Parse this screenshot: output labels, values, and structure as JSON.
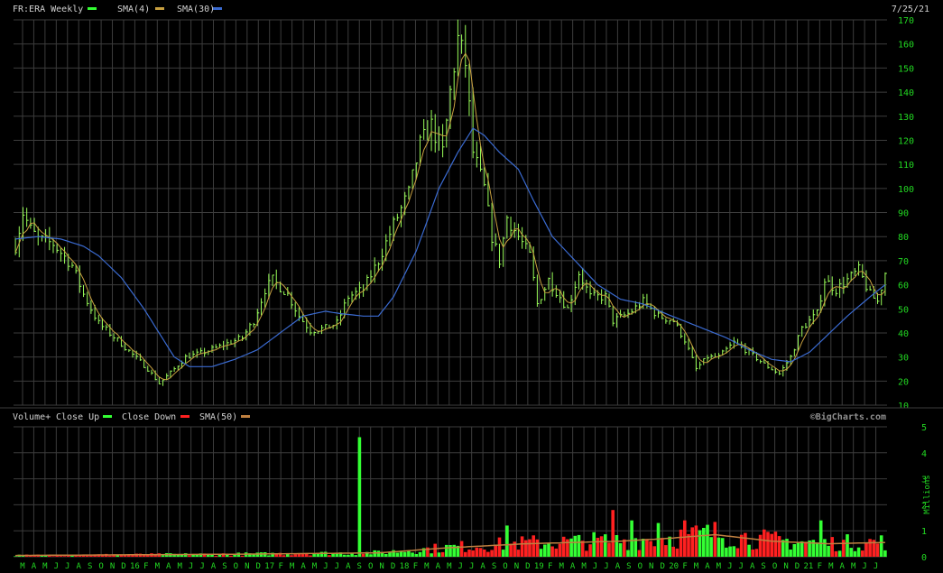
{
  "header": {
    "symbol_label": "FR:ERA Weekly",
    "sma4_label": "SMA(4)",
    "sma30_label": "SMA(30)",
    "date": "7/25/21"
  },
  "volume_header": {
    "label": "Volume+",
    "close_up_label": "Close Up",
    "close_down_label": "Close Down",
    "sma50_label": "SMA(50)",
    "watermark": "©BigCharts.com",
    "unit_label": "Millions"
  },
  "colors": {
    "background": "#000000",
    "grid": "#3c3c3c",
    "price_bar": "#9aff5a",
    "axis_text": "#22d822",
    "header_text": "#d0d0d0",
    "sma4": "#c8a040",
    "sma30": "#3a6ad0",
    "vol_up": "#33ff33",
    "vol_down": "#ff2020",
    "vol_sma": "#c08040",
    "watermark": "#909090"
  },
  "chart_data": [
    {
      "type": "line",
      "title": "FR:ERA Weekly",
      "ylim": [
        10,
        170
      ],
      "yticks": [
        10,
        20,
        30,
        40,
        50,
        60,
        70,
        80,
        90,
        100,
        110,
        120,
        130,
        140,
        150,
        160,
        170
      ],
      "grid": true,
      "legend": "top-left",
      "x_labels": [
        "M",
        "A",
        "M",
        "J",
        "J",
        "A",
        "S",
        "O",
        "N",
        "D",
        "16",
        "F",
        "M",
        "A",
        "M",
        "J",
        "J",
        "A",
        "S",
        "O",
        "N",
        "D",
        "17",
        "F",
        "M",
        "A",
        "M",
        "J",
        "J",
        "A",
        "S",
        "O",
        "N",
        "D",
        "18",
        "F",
        "M",
        "A",
        "M",
        "J",
        "J",
        "A",
        "S",
        "O",
        "N",
        "D",
        "19",
        "F",
        "M",
        "A",
        "M",
        "J",
        "J",
        "A",
        "S",
        "O",
        "N",
        "D",
        "20",
        "F",
        "M",
        "A",
        "M",
        "J",
        "J",
        "A",
        "S",
        "O",
        "N",
        "D",
        "21",
        "F",
        "M",
        "A",
        "M",
        "J",
        "J"
      ],
      "series": [
        {
          "name": "FR:ERA Weekly",
          "key_points": [
            [
              0,
              76
            ],
            [
              2,
              90
            ],
            [
              4,
              83
            ],
            [
              6,
              79
            ],
            [
              10,
              77
            ],
            [
              15,
              68
            ],
            [
              18,
              56
            ],
            [
              22,
              44
            ],
            [
              27,
              37
            ],
            [
              31,
              31
            ],
            [
              35,
              25
            ],
            [
              38,
              19
            ],
            [
              42,
              25
            ],
            [
              45,
              30
            ],
            [
              50,
              32
            ],
            [
              55,
              35
            ],
            [
              60,
              38
            ],
            [
              63,
              45
            ],
            [
              66,
              58
            ],
            [
              68,
              62
            ],
            [
              72,
              56
            ],
            [
              75,
              47
            ],
            [
              78,
              41
            ],
            [
              82,
              42
            ],
            [
              85,
              44
            ],
            [
              88,
              55
            ],
            [
              92,
              58
            ],
            [
              96,
              70
            ],
            [
              100,
              85
            ],
            [
              104,
              98
            ],
            [
              107,
              118
            ],
            [
              110,
              126
            ],
            [
              113,
              115
            ],
            [
              115,
              140
            ],
            [
              117,
              162
            ],
            [
              119,
              152
            ],
            [
              121,
              115
            ],
            [
              124,
              100
            ],
            [
              126,
              80
            ],
            [
              128,
              70
            ],
            [
              130,
              88
            ],
            [
              133,
              80
            ],
            [
              136,
              72
            ],
            [
              138,
              52
            ],
            [
              141,
              62
            ],
            [
              144,
              55
            ],
            [
              146,
              50
            ],
            [
              149,
              65
            ],
            [
              152,
              55
            ],
            [
              156,
              55
            ],
            [
              158,
              45
            ],
            [
              162,
              48
            ],
            [
              166,
              53
            ],
            [
              170,
              47
            ],
            [
              174,
              45
            ],
            [
              177,
              37
            ],
            [
              180,
              25
            ],
            [
              183,
              30
            ],
            [
              186,
              30
            ],
            [
              190,
              36
            ],
            [
              194,
              32
            ],
            [
              198,
              27
            ],
            [
              202,
              23
            ],
            [
              205,
              30
            ],
            [
              208,
              42
            ],
            [
              212,
              48
            ],
            [
              214,
              62
            ],
            [
              217,
              58
            ],
            [
              220,
              62
            ],
            [
              223,
              66
            ],
            [
              226,
              56
            ],
            [
              228,
              53
            ],
            [
              230,
              65
            ]
          ]
        },
        {
          "name": "SMA(4)",
          "smoothing": 4
        },
        {
          "name": "SMA(30)",
          "key_points": [
            [
              0,
              79
            ],
            [
              6,
              80
            ],
            [
              12,
              79
            ],
            [
              18,
              76
            ],
            [
              22,
              72
            ],
            [
              28,
              63
            ],
            [
              34,
              50
            ],
            [
              38,
              40
            ],
            [
              42,
              30
            ],
            [
              46,
              26
            ],
            [
              52,
              26
            ],
            [
              58,
              29
            ],
            [
              64,
              33
            ],
            [
              70,
              40
            ],
            [
              76,
              47
            ],
            [
              82,
              49
            ],
            [
              86,
              48
            ],
            [
              92,
              47
            ],
            [
              96,
              47
            ],
            [
              100,
              55
            ],
            [
              106,
              74
            ],
            [
              112,
              100
            ],
            [
              117,
              115
            ],
            [
              121,
              125
            ],
            [
              124,
              122
            ],
            [
              128,
              115
            ],
            [
              133,
              108
            ],
            [
              137,
              95
            ],
            [
              142,
              80
            ],
            [
              148,
              70
            ],
            [
              154,
              60
            ],
            [
              160,
              54
            ],
            [
              166,
              52
            ],
            [
              172,
              48
            ],
            [
              180,
              43
            ],
            [
              188,
              38
            ],
            [
              194,
              33
            ],
            [
              200,
              29
            ],
            [
              205,
              28
            ],
            [
              210,
              32
            ],
            [
              214,
              38
            ],
            [
              220,
              47
            ],
            [
              226,
              55
            ],
            [
              230,
              60
            ]
          ]
        }
      ]
    },
    {
      "type": "bar",
      "title": "Volume+",
      "ylim": [
        0,
        5
      ],
      "yticks": [
        0,
        1,
        2,
        3,
        4,
        5
      ],
      "ylabel": "Millions",
      "grid": true,
      "legend": "top-left",
      "series": [
        {
          "name": "Close Up"
        },
        {
          "name": "Close Down"
        },
        {
          "name": "SMA(50)",
          "key_points": [
            [
              0,
              0.05
            ],
            [
              60,
              0.1
            ],
            [
              96,
              0.15
            ],
            [
              115,
              0.35
            ],
            [
              135,
              0.5
            ],
            [
              160,
              0.6
            ],
            [
              172,
              0.7
            ],
            [
              185,
              0.85
            ],
            [
              200,
              0.6
            ],
            [
              215,
              0.5
            ],
            [
              230,
              0.55
            ]
          ]
        }
      ],
      "highlights": [
        [
          91,
          4.6
        ],
        [
          130,
          1.2
        ],
        [
          158,
          1.8
        ],
        [
          163,
          1.4
        ],
        [
          170,
          1.3
        ],
        [
          177,
          1.4
        ],
        [
          213,
          1.4
        ]
      ]
    }
  ]
}
